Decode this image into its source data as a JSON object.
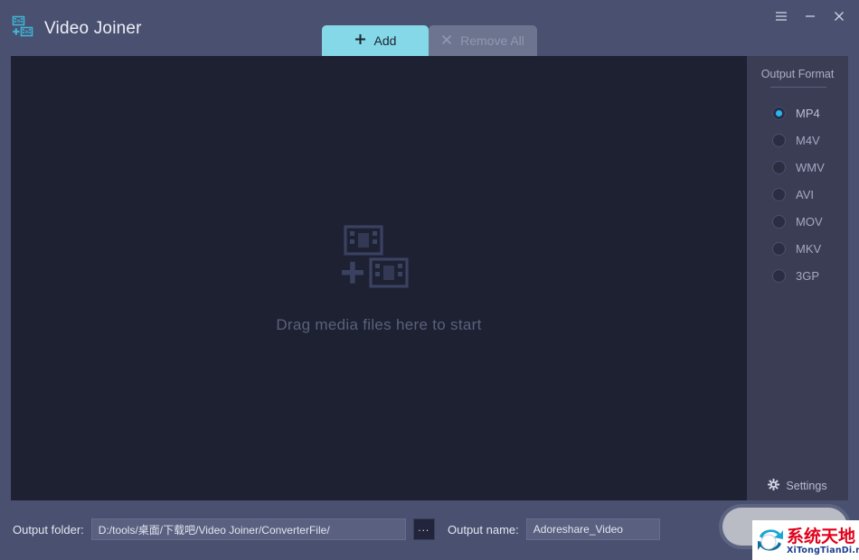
{
  "window": {
    "title": "Video Joiner",
    "logo_icon": "video-join-icon",
    "controls": {
      "menu": "menu-icon",
      "minimize": "minimize-icon",
      "close": "close-icon"
    }
  },
  "tabs": [
    {
      "id": "add",
      "label": "Add",
      "icon": "plus-icon",
      "active": true
    },
    {
      "id": "remove-all",
      "label": "Remove All",
      "icon": "close-x-icon",
      "active": false
    }
  ],
  "stage": {
    "drop_icon": "video-join-icon",
    "drop_text": "Drag media files here to start"
  },
  "panel": {
    "title": "Output Format",
    "formats": [
      {
        "label": "MP4",
        "selected": true
      },
      {
        "label": "M4V",
        "selected": false
      },
      {
        "label": "WMV",
        "selected": false
      },
      {
        "label": "AVI",
        "selected": false
      },
      {
        "label": "MOV",
        "selected": false
      },
      {
        "label": "MKV",
        "selected": false
      },
      {
        "label": "3GP",
        "selected": false
      }
    ],
    "settings": {
      "label": "Settings",
      "icon": "gear-icon"
    }
  },
  "bottom": {
    "folder_label": "Output folder:",
    "folder_value": "D:/tools/桌面/下载吧/Video Joiner/ConverterFile/",
    "browse_label": "...",
    "name_label": "Output name:",
    "name_value": "Adoreshare_Video",
    "join_button_label": ""
  },
  "watermark": {
    "cn_text": "系统天地",
    "en_text": "XiTongTianDi.net",
    "logo_icon": "recycle-arrows-icon"
  },
  "colors": {
    "frame": "#4a5070",
    "stage": "#1d2132",
    "panel": "#3b3d55",
    "accent": "#85d8e8",
    "radio_on": "#29b6f0",
    "logo": "#3fb6d8"
  }
}
